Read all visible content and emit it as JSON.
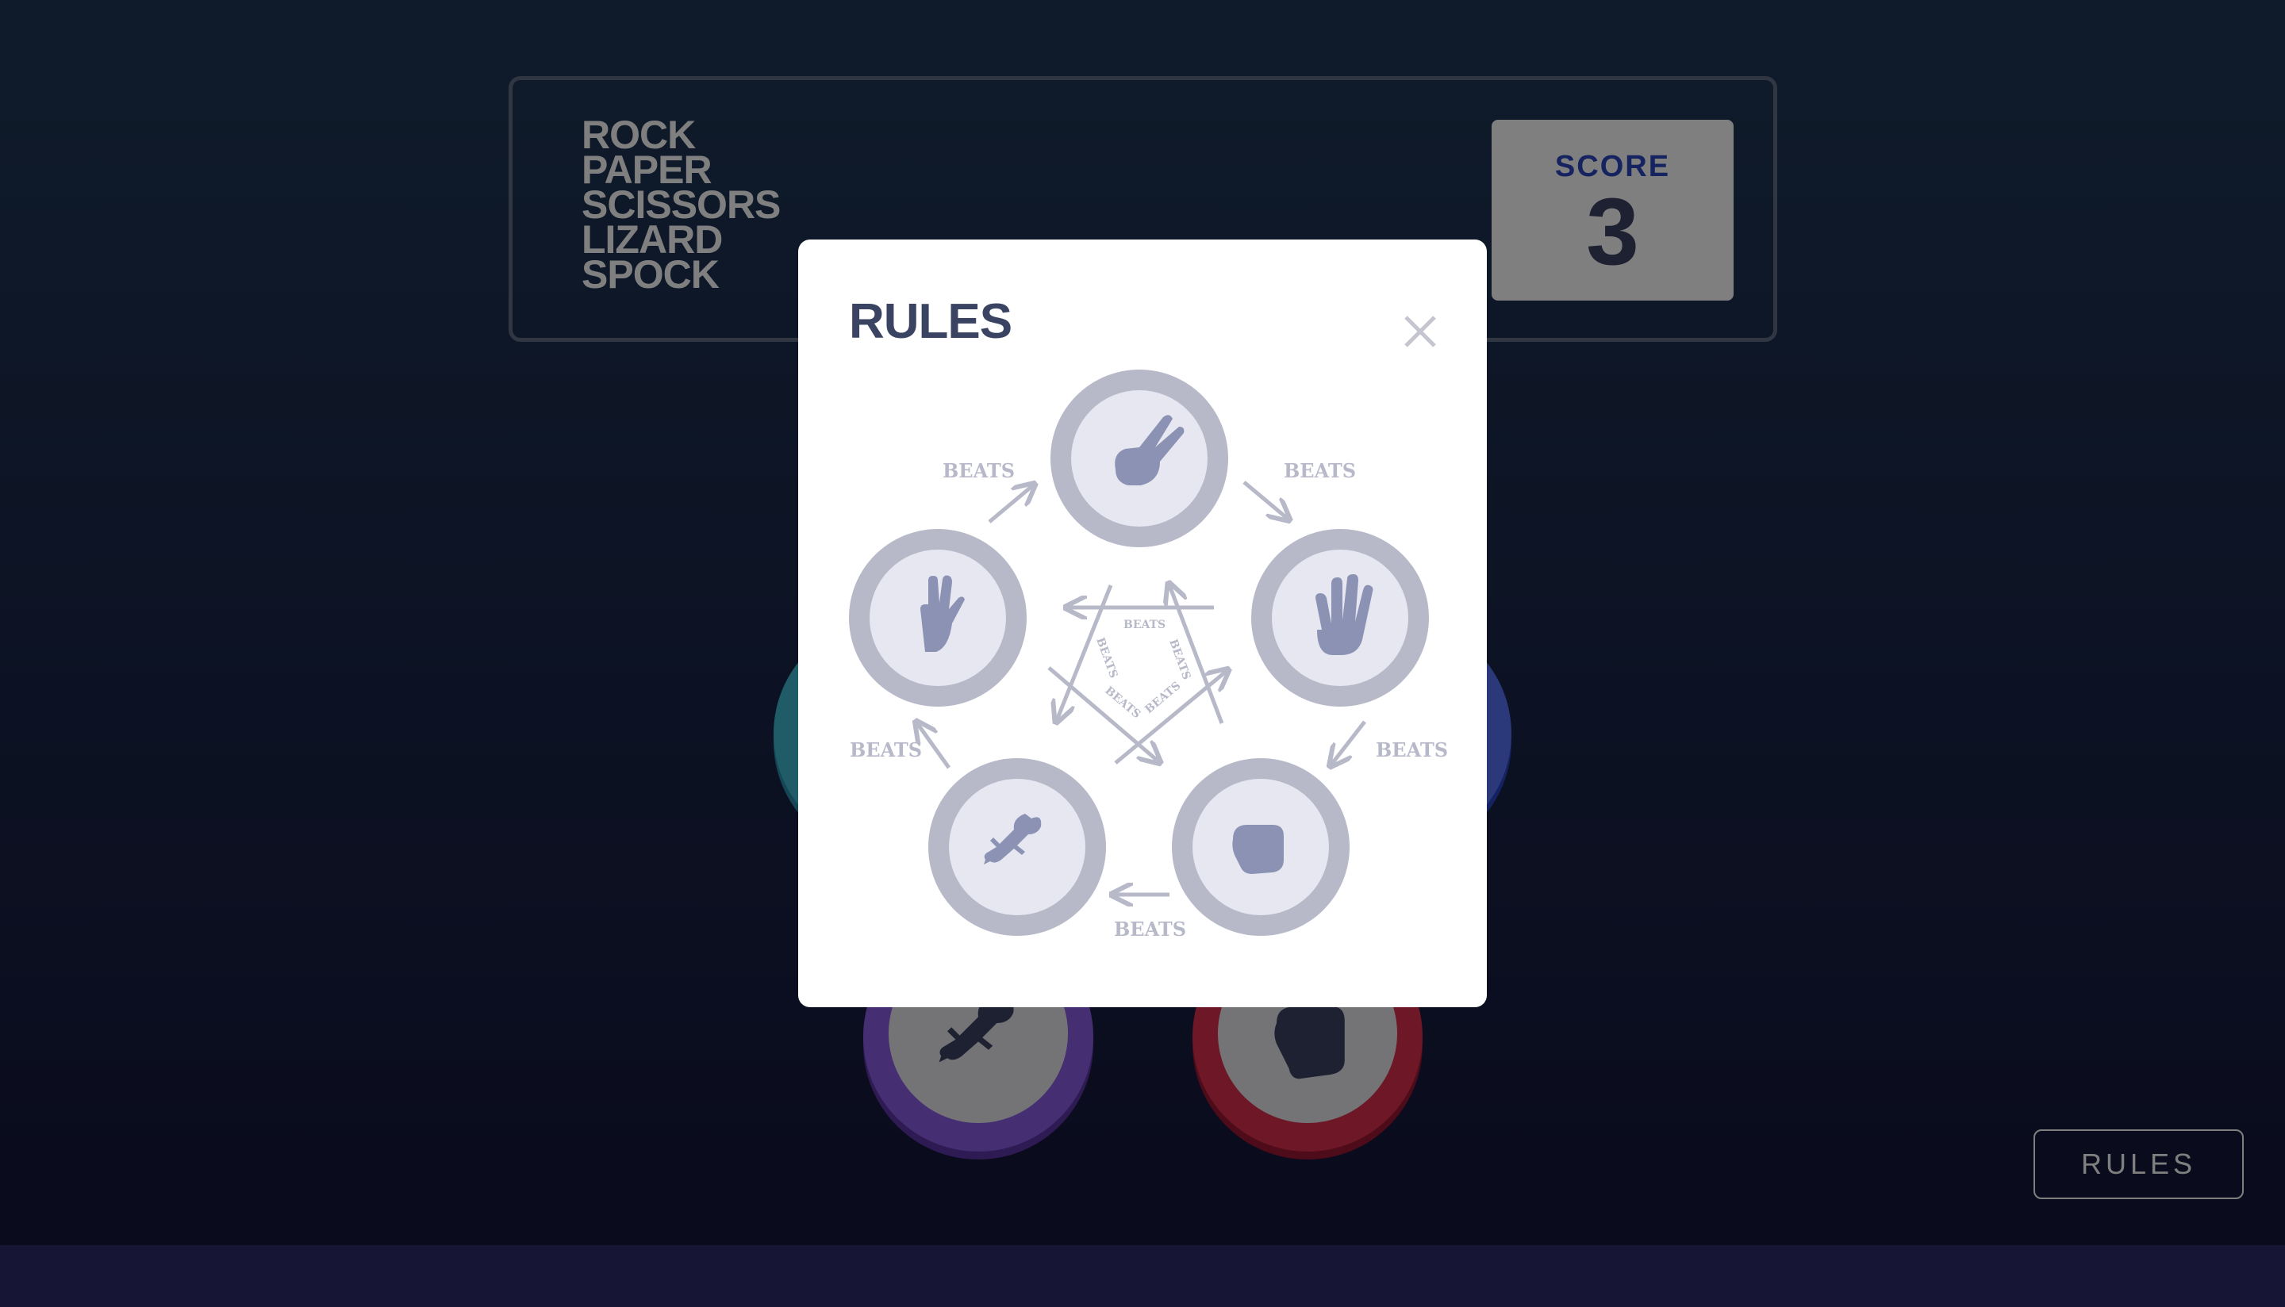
{
  "header": {
    "logo_lines": [
      "ROCK",
      "PAPER",
      "SCISSORS",
      "LIZARD",
      "SPOCK"
    ],
    "score_label": "SCORE",
    "score_value": "3"
  },
  "board": {
    "tokens": [
      {
        "name": "lizard",
        "icon": "lizard-icon",
        "color": "#8c5de5"
      },
      {
        "name": "rock",
        "icon": "rock-icon",
        "color": "#dc2e4e"
      },
      {
        "name": "spock",
        "icon": "spock-icon",
        "color": "#40b9ce"
      },
      {
        "name": "paper",
        "icon": "paper-icon",
        "color": "#5671f5"
      }
    ]
  },
  "footer": {
    "rules_button_label": "RULES"
  },
  "modal": {
    "title": "RULES",
    "close_icon": "close-icon",
    "diagram": {
      "nodes": [
        {
          "name": "scissors",
          "icon": "scissors-icon"
        },
        {
          "name": "paper",
          "icon": "paper-icon"
        },
        {
          "name": "rock",
          "icon": "rock-icon"
        },
        {
          "name": "lizard",
          "icon": "lizard-icon"
        },
        {
          "name": "spock",
          "icon": "spock-icon"
        }
      ],
      "beats_label": "BEATS"
    }
  },
  "colors": {
    "background_top": "#1f3756",
    "background_bottom": "#141539",
    "dark_text": "#3b4363",
    "score_text": "#2a46c0",
    "diagram_gray": "#b7b9c9",
    "icon_gray": "#8c92b3"
  }
}
